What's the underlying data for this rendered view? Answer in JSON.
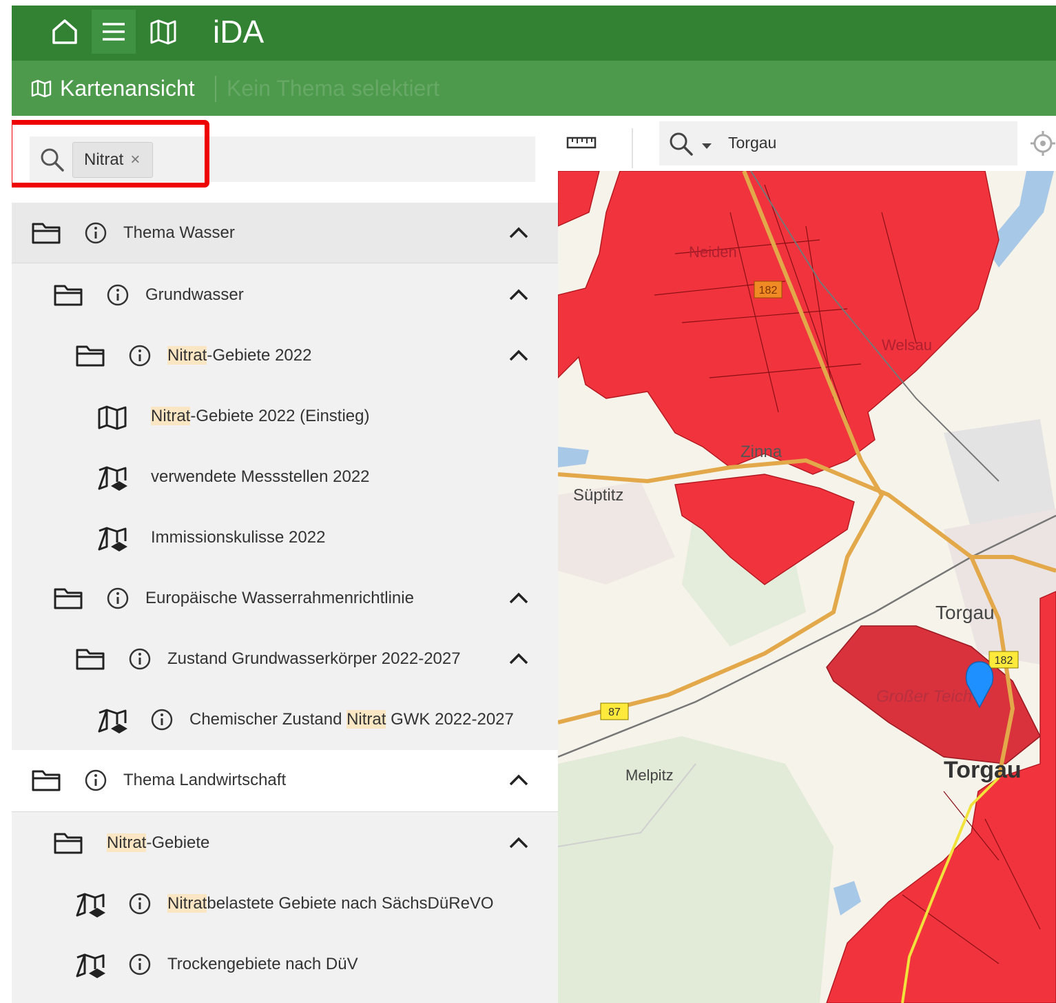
{
  "app": {
    "title": "iDA"
  },
  "header": {
    "home_icon": "home-icon",
    "menu_icon": "menu-icon",
    "map_icon": "map-icon"
  },
  "subheader": {
    "view_label": "Kartenansicht",
    "theme_status": "Kein Thema selektiert"
  },
  "search": {
    "chip_label": "Nitrat",
    "chip_remove": "×"
  },
  "tree": {
    "r1": {
      "label": "Thema Wasser"
    },
    "r2": {
      "label": "Grundwasser"
    },
    "r3": {
      "hl": "Nitrat",
      "rest": "-Gebiete 2022"
    },
    "r4": {
      "hl": "Nitrat",
      "rest": "-Gebiete 2022 (Einstieg)"
    },
    "r5": {
      "label": "verwendete Messstellen 2022"
    },
    "r6": {
      "label": "Immissionskulisse 2022"
    },
    "r7": {
      "label": "Europäische Wasserrahmenrichtlinie"
    },
    "r8": {
      "label": "Zustand Grundwasserkörper 2022-2027"
    },
    "r9": {
      "pre": "Chemischer Zustand ",
      "hl": "Nitrat",
      "post": " GWK 2022-2027"
    },
    "r10": {
      "label": "Thema Landwirtschaft"
    },
    "r11": {
      "hl": "Nitrat",
      "rest": "-Gebiete"
    },
    "r12": {
      "hl": "Nitrat",
      "rest": "belastete Gebiete nach SächsDüReVO"
    },
    "r13": {
      "label": "Trockengebiete nach DüV"
    }
  },
  "map": {
    "search_value": "Torgau",
    "places": {
      "neiden": "Neiden",
      "welsau": "Welsau",
      "zinna": "Zinna",
      "sueptitz": "Süptitz",
      "torgau_label": "Torgau",
      "grosser_teich": "Großer Teich",
      "torgau_city": "Torgau",
      "melpitz": "Melpitz"
    },
    "roads": {
      "b182a": "182",
      "b182b": "182",
      "b87": "87"
    },
    "colors": {
      "area": "#f0333d",
      "area_selected": "#d9323c",
      "road": "#e2a84a",
      "water": "#a8c8e8",
      "marker": "#1e90ff",
      "header": "#338234",
      "subheader": "#4d9a4d",
      "highlight": "#ee0000"
    }
  }
}
